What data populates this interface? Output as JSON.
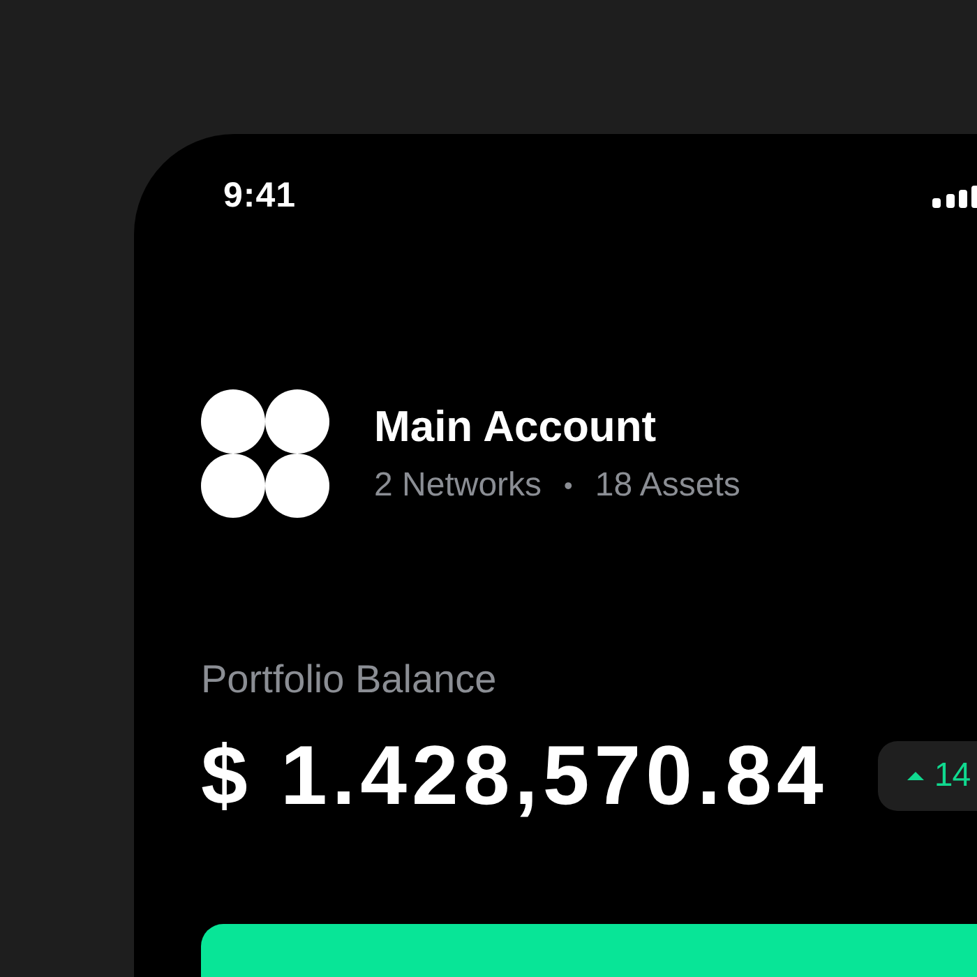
{
  "status_bar": {
    "time": "9:41"
  },
  "account": {
    "name": "Main Account",
    "networks": "2 Networks",
    "separator": "•",
    "assets": "18 Assets"
  },
  "portfolio": {
    "label": "Portfolio Balance",
    "balance": "$ 1.428,570.84",
    "change": {
      "rising": true,
      "text": "14"
    }
  },
  "action_button": {
    "kind": "primary"
  }
}
